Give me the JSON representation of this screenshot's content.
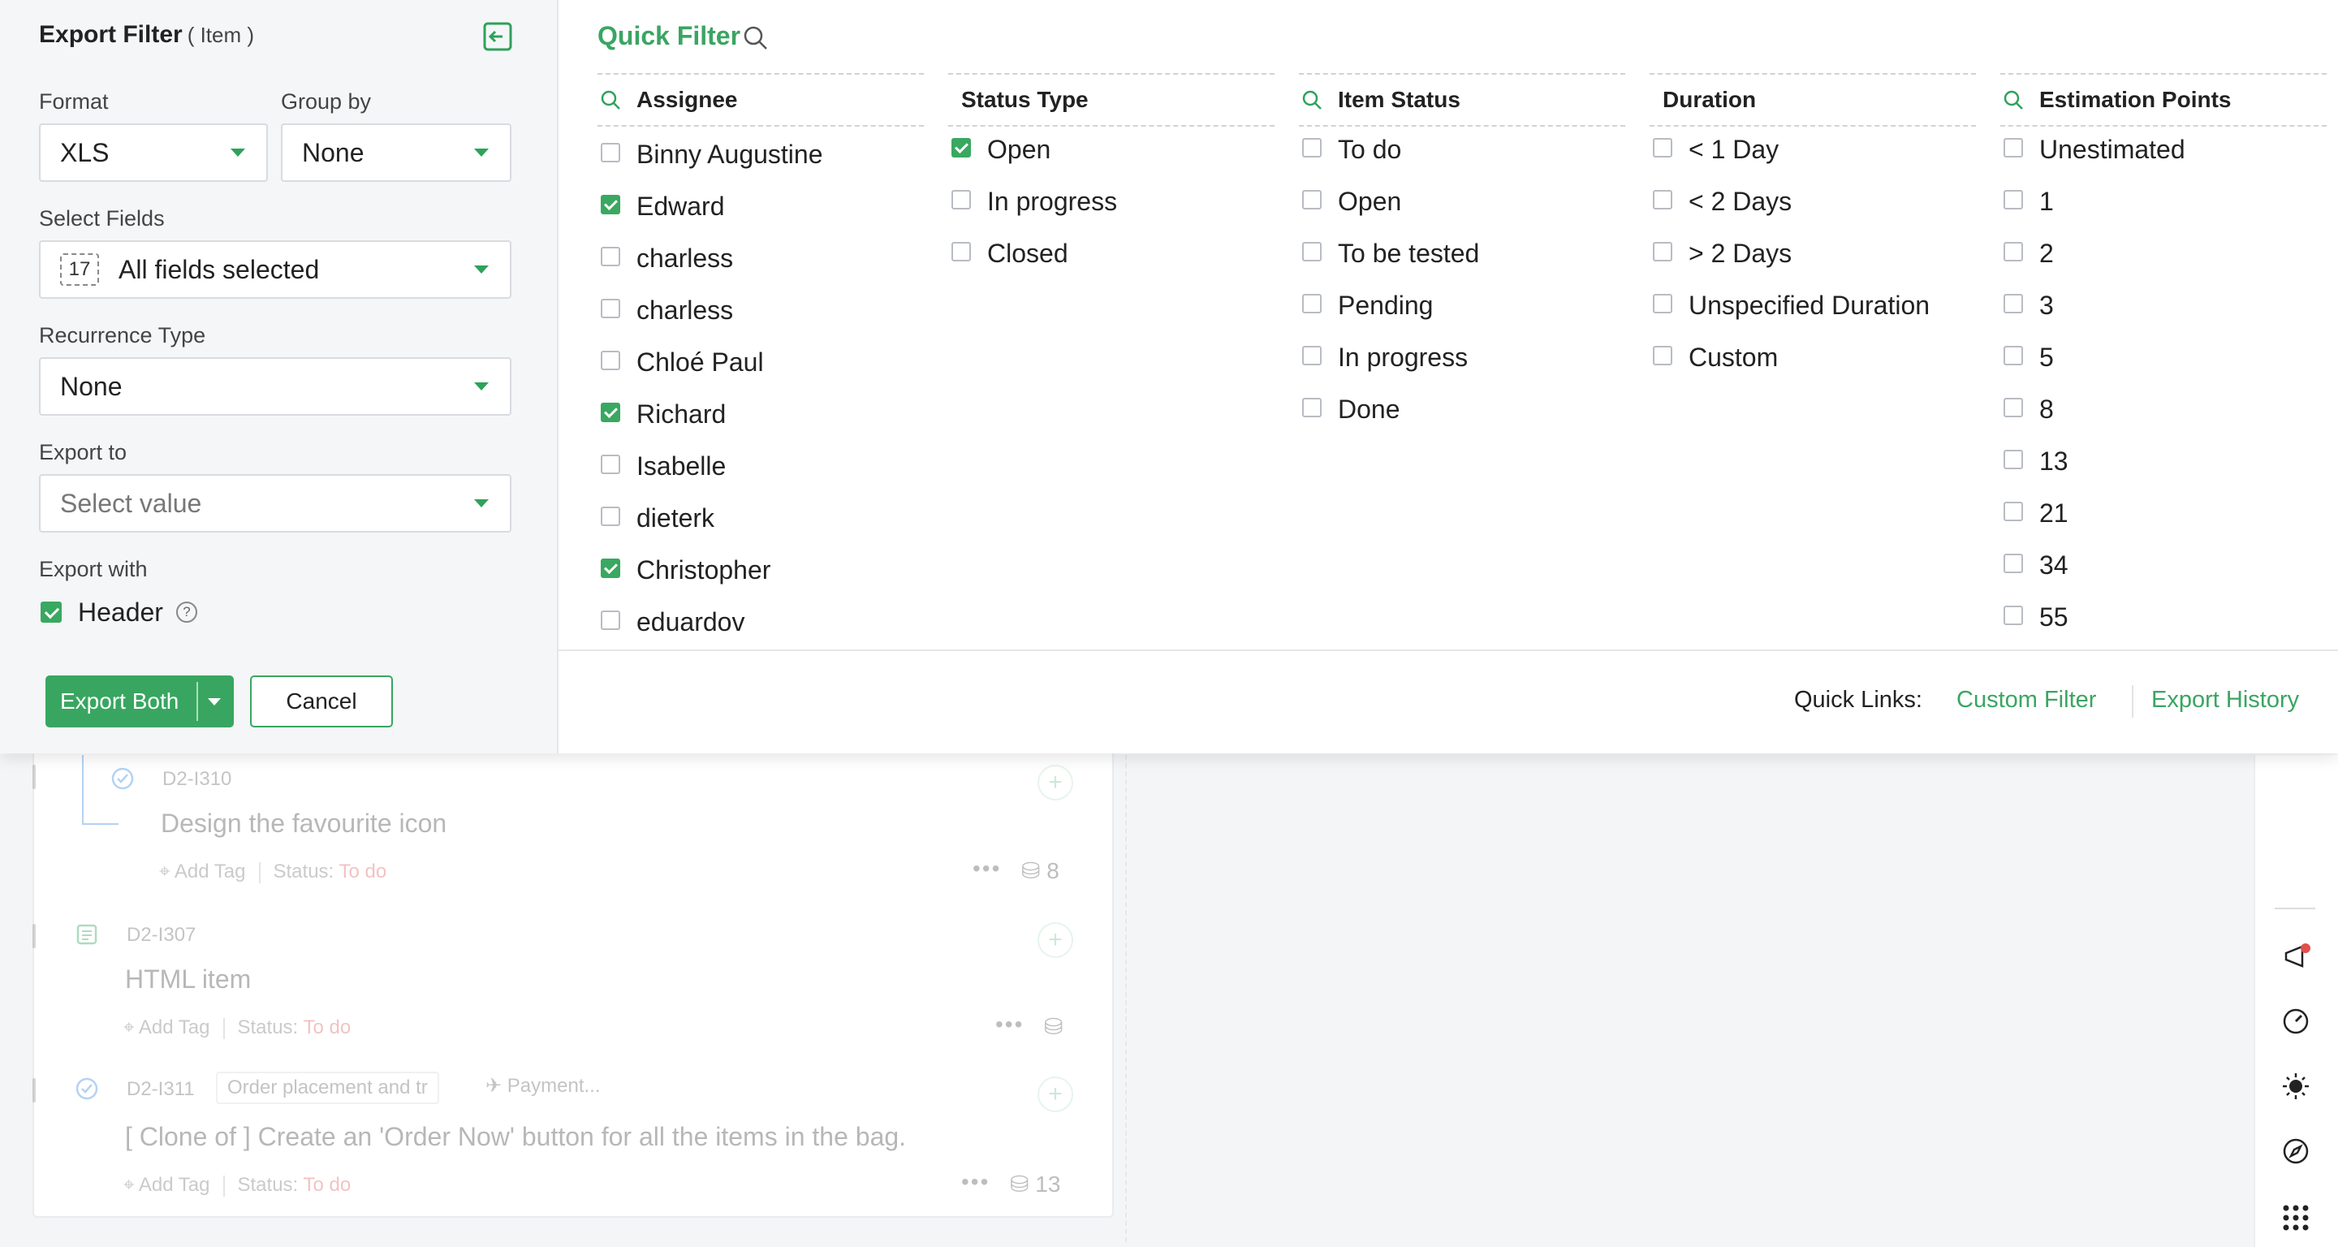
{
  "export_filter": {
    "title": "Export Filter",
    "subtitle": "( Item )",
    "format": {
      "label": "Format",
      "value": "XLS"
    },
    "group_by": {
      "label": "Group by",
      "value": "None"
    },
    "select_fields": {
      "label": "Select Fields",
      "count": "17",
      "value": "All fields selected"
    },
    "recurrence_type": {
      "label": "Recurrence Type",
      "value": "None"
    },
    "export_to": {
      "label": "Export to",
      "placeholder": "Select value"
    },
    "export_with": {
      "label": "Export with",
      "header_label": "Header",
      "header_checked": true,
      "help_glyph": "?"
    },
    "export_button": "Export Both",
    "cancel_button": "Cancel"
  },
  "quick_filter": {
    "title": "Quick Filter",
    "columns": [
      {
        "title": "Assignee",
        "searchable": true,
        "options": [
          {
            "label": "Binny Augustine",
            "checked": false
          },
          {
            "label": "Edward",
            "checked": true
          },
          {
            "label": "charless",
            "checked": false
          },
          {
            "label": "charless",
            "checked": false
          },
          {
            "label": "Chloé Paul",
            "checked": false
          },
          {
            "label": "Richard",
            "checked": true
          },
          {
            "label": "Isabelle",
            "checked": false
          },
          {
            "label": "dieterk",
            "checked": false
          },
          {
            "label": "Christopher",
            "checked": true
          },
          {
            "label": "eduardov",
            "checked": false
          }
        ]
      },
      {
        "title": "Status Type",
        "searchable": false,
        "options": [
          {
            "label": "Open",
            "checked": true
          },
          {
            "label": "In progress",
            "checked": false
          },
          {
            "label": "Closed",
            "checked": false
          }
        ]
      },
      {
        "title": "Item Status",
        "searchable": true,
        "options": [
          {
            "label": "To do",
            "checked": false
          },
          {
            "label": "Open",
            "checked": false
          },
          {
            "label": "To be tested",
            "checked": false
          },
          {
            "label": "Pending",
            "checked": false
          },
          {
            "label": "In progress",
            "checked": false
          },
          {
            "label": "Done",
            "checked": false
          }
        ]
      },
      {
        "title": "Duration",
        "searchable": false,
        "options": [
          {
            "label": "< 1 Day",
            "checked": false
          },
          {
            "label": "< 2 Days",
            "checked": false
          },
          {
            "label": "> 2 Days",
            "checked": false
          },
          {
            "label": "Unspecified Duration",
            "checked": false
          },
          {
            "label": "Custom",
            "checked": false
          }
        ]
      },
      {
        "title": "Estimation Points",
        "searchable": true,
        "options": [
          {
            "label": "Unestimated",
            "checked": false
          },
          {
            "label": "1",
            "checked": false
          },
          {
            "label": "2",
            "checked": false
          },
          {
            "label": "3",
            "checked": false
          },
          {
            "label": "5",
            "checked": false
          },
          {
            "label": "8",
            "checked": false
          },
          {
            "label": "13",
            "checked": false
          },
          {
            "label": "21",
            "checked": false
          },
          {
            "label": "34",
            "checked": false
          },
          {
            "label": "55",
            "checked": false
          }
        ]
      }
    ]
  },
  "quick_links": {
    "label": "Quick Links:",
    "custom_filter": "Custom Filter",
    "export_history": "Export History"
  },
  "background_items": [
    {
      "id": "D2-I310",
      "title": "Design the favourite icon",
      "add_tag": "Add Tag",
      "status_label": "Status:",
      "status": "To do",
      "points": "8"
    },
    {
      "id": "D2-I307",
      "title": "HTML item",
      "add_tag": "Add Tag",
      "status_label": "Status:",
      "status": "To do",
      "points": ""
    },
    {
      "id": "D2-I311",
      "title": "[ Clone of ] Create an 'Order Now' button for all the items in the bag.",
      "add_tag": "Add Tag",
      "status_label": "Status:",
      "status": "To do",
      "points": "13",
      "tags": [
        "Order placement and tr",
        "Payment..."
      ]
    }
  ],
  "colors": {
    "accent": "#38a660",
    "todo": "#e06060"
  },
  "icons": {
    "collapse": "collapse-panel-icon",
    "search": "search-icon",
    "help": "help-icon",
    "rail": [
      "announcement-icon",
      "speed-icon",
      "theme-icon",
      "compass-icon",
      "apps-grid-icon"
    ]
  }
}
